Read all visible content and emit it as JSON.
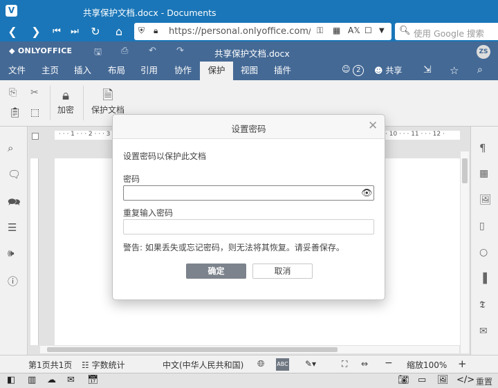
{
  "browser": {
    "window_title": "共享保护文档.docx - Documents",
    "url": "https://personal.onlyoffice.com/pr...",
    "search_placeholder": "使用 Google 搜索"
  },
  "editor": {
    "brand": "ONLYOFFICE",
    "doc_title": "共享保护文档.docx",
    "avatar_initials": "ZS",
    "tabs": [
      "文件",
      "主页",
      "插入",
      "布局",
      "引用",
      "协作",
      "保护",
      "视图",
      "插件"
    ],
    "active_tab": "保护",
    "users_count": "2",
    "share_label": "共享"
  },
  "ribbon": {
    "encrypt_label": "加密",
    "protect_doc_label": "保护文档"
  },
  "ruler": {
    "left_marks": "· · · 1 · · · 2 · · · 3",
    "right_marks": "· 10 · · · 11 · · · 12 ·"
  },
  "dialog": {
    "title": "设置密码",
    "description": "设置密码以保护此文档",
    "password_label": "密码",
    "password_value": "",
    "repeat_label": "重复输入密码",
    "repeat_value": "",
    "warning": "警告: 如果丢失或忘记密码，则无法将其恢复。请妥善保存。",
    "ok_label": "确定",
    "cancel_label": "取消"
  },
  "statusbar": {
    "page_info": "第1页共1页",
    "word_count": "字数统计",
    "language": "中文(中华人民共和国)",
    "zoom": "缩放100%"
  },
  "bottombar": {
    "reset_label": "重置"
  },
  "colors": {
    "browser_blue": "#1a76b8",
    "editor_header": "#446995",
    "ok_button": "#7c838c"
  }
}
